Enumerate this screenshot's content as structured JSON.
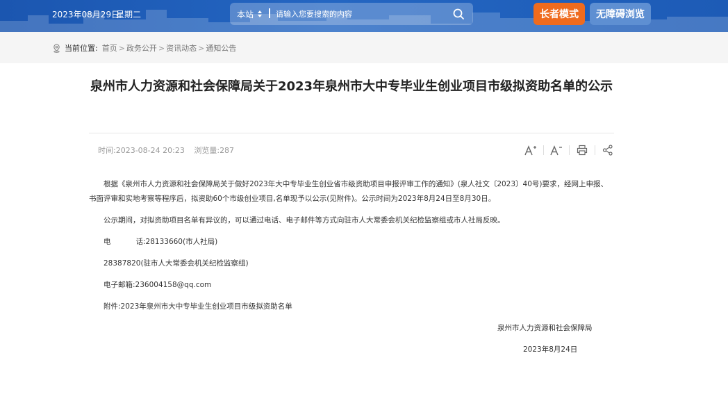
{
  "header": {
    "date": "2023年08月29日",
    "weekday": "星期二",
    "search": {
      "scope": "本站",
      "placeholder": "请输入您要搜索的内容"
    },
    "elder_mode_label": "长者模式",
    "accessible_label": "无障碍浏览",
    "colors": {
      "bar": "#1f5cb8",
      "elder": "#ef6b1e",
      "accessible": "#5e8fd2"
    }
  },
  "breadcrumb": {
    "label": "当前位置:",
    "items": [
      "首页",
      "政务公开",
      "资讯动态",
      "通知公告"
    ],
    "separator": ">"
  },
  "article": {
    "title": "泉州市人力资源和社会保障局关于2023年泉州市大中专毕业生创业项目市级拟资助名单的公示",
    "time_label": "时间:",
    "time_value": "2023-08-24 20:23",
    "views_label": "浏览量:",
    "views_value": "287",
    "tools": [
      {
        "icon": "font-increase-icon"
      },
      {
        "icon": "font-decrease-icon"
      },
      {
        "icon": "print-icon"
      },
      {
        "icon": "share-icon"
      }
    ],
    "paragraphs": {
      "p1": "根据《泉州市人力资源和社会保障局关于做好2023年大中专毕业生创业省市级资助项目申报评审工作的通知》(泉人社文〔2023〕40号)要求，经网上申报、书面评审和实地考察等程序后，拟资助60个市级创业项目,名单现予以公示(见附件)。公示时间为2023年8月24日至8月30日。",
      "p2": "公示期间，对拟资助项目名单有异议的，可以通过电话、电子邮件等方式向驻市人大常委会机关纪检监察组或市人社局反映。",
      "phone_label_a": "电",
      "phone_label_b": "话:",
      "phone_value": "28133660(市人社局)",
      "p4": "28387820(驻市人大常委会机关纪检监察组)",
      "email": "电子邮箱:236004158@qq.com",
      "attachment": "附件:2023年泉州市大中专毕业生创业项目市级拟资助名单",
      "signature_org": "泉州市人力资源和社会保障局",
      "signature_date": "2023年8月24日"
    }
  }
}
